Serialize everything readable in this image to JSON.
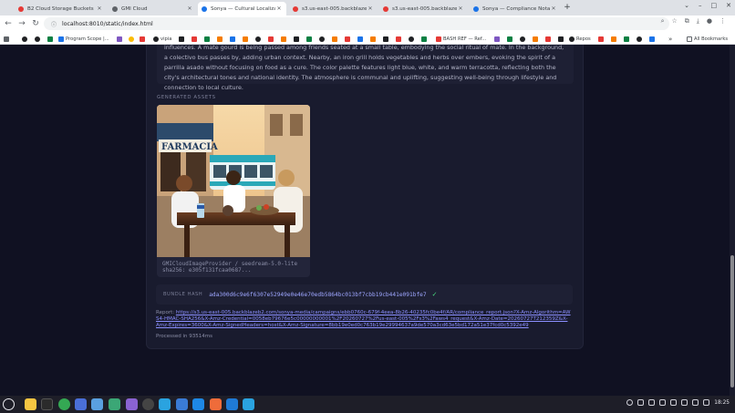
{
  "browser": {
    "tabs": [
      {
        "title": "B2 Cloud Storage Buckets",
        "active": false,
        "favicon_color": "#e53935"
      },
      {
        "title": "GMI Cloud",
        "active": false,
        "favicon_color": "#5f6368"
      },
      {
        "title": "Sonya — Cultural Localization",
        "active": true,
        "favicon_color": "#1a73e8"
      },
      {
        "title": "s3.us-east-005.backblazeb2",
        "active": false,
        "favicon_color": "#e53935"
      },
      {
        "title": "s3.us-east-005.backblazeb2",
        "active": false,
        "favicon_color": "#e53935"
      },
      {
        "title": "Sonya — Compliance Notar",
        "active": false,
        "favicon_color": "#1a73e8"
      }
    ],
    "new_tab": "+",
    "url": "localhost:8010/static/index.html",
    "bookmarks": [
      {
        "label": "Program Scope |...",
        "color": "#1a73e8"
      },
      {
        "label": "vipia",
        "color": "#202124"
      },
      {
        "label": "BASH REF — Ref...",
        "color": "#e53935"
      },
      {
        "label": "Repos",
        "color": "#202124"
      }
    ],
    "all_bookmarks": "All Bookmarks"
  },
  "main": {
    "description": "influences. A mate gourd is being passed among friends seated at a small table, embodying the social ritual of mate. In the background, a colectivo bus passes by, adding urban context. Nearby, an iron grill holds vegetables and herbs over embers, evoking the spirit of a parrilla asado without focusing on food as a cure. The color palette features light blue, white, and warm terracotta, reflecting both the city's architectural tones and national identity. The atmosphere is communal and uplifting, suggesting well-being through lifestyle and connection to local culture.",
    "assets_label": "GENERATED ASSETS",
    "asset": {
      "sign_text": "FARMACIA",
      "provider": "GMICloudImageProvider / seedream-5.0-lite",
      "sha": "sha256: e305f131fcaa0687..."
    },
    "bundle": {
      "label": "BUNDLE HASH",
      "value": "ada300d6c9e6f6307e52949e0e46e70edb5864bc013bf7cbb19cb441e091bfe7",
      "check": "✓"
    },
    "report": {
      "label": "Report:",
      "url": "https://s3.us-east-005.backblazeb2.com/sonya-media/campaigns/ebb0760c-679f-4eea-8b26-40235fc0be4f/AR/compliance_report.json?X-Amz-Algorithm=AWS4-HMAC-SHA256&X-Amz-Credential=0058eb79676e5c00000000001%2F20260727%2Fus-east-005%2Fs3%2Faws4_request&X-Amz-Date=20260727T212359Z&X-Amz-Expires=3600&X-Amz-SignedHeaders=host&X-Amz-Signature=8bb19e0ed0c763b19e29994637a9de570a3cd63e5bd172a51e37fcd0c5392e49"
    },
    "processed": "Processed in 93514ms"
  },
  "taskbar": {
    "time": "18:25"
  }
}
